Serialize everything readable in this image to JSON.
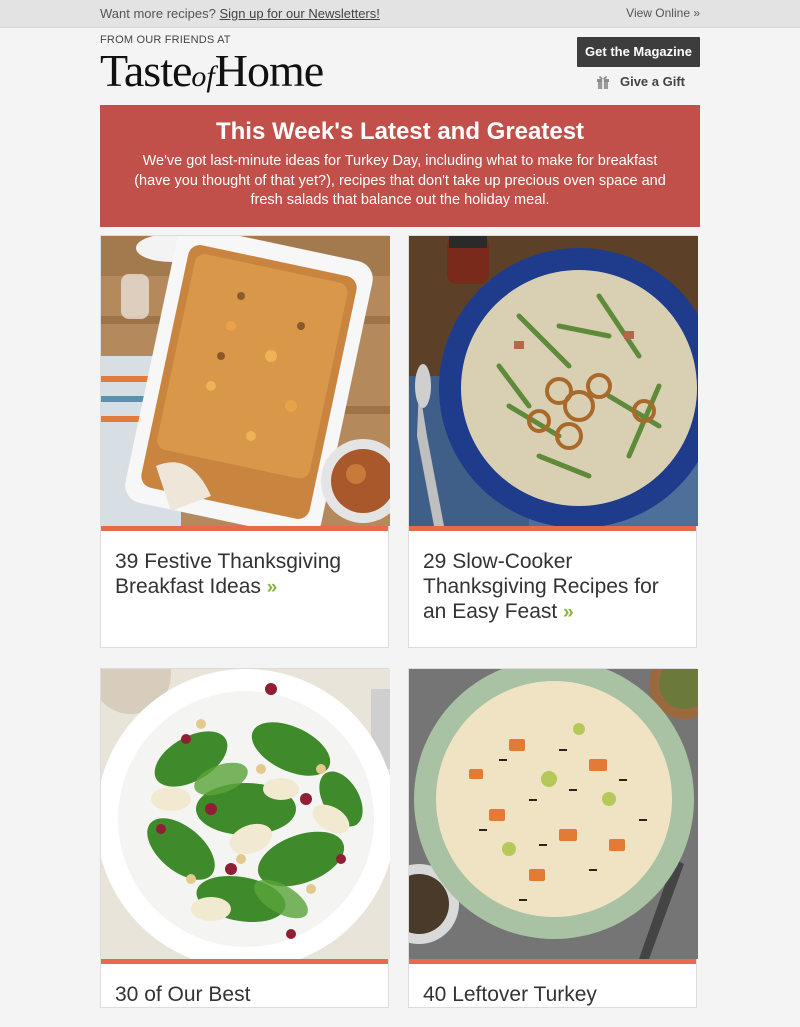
{
  "topbar": {
    "prompt": "Want more recipes?",
    "signup_link": "Sign up for our Newsletters!",
    "view_online": "View Online »"
  },
  "header": {
    "friends_label": "FROM OUR FRIENDS AT",
    "logo_part1": "Taste",
    "logo_part2": "of",
    "logo_part3": "Home",
    "magazine_button": "Get the Magazine",
    "gift_label": "Give a Gift"
  },
  "hero": {
    "title": "This Week's Latest and Greatest",
    "body": "We've got last-minute ideas for Turkey Day, including what to make for breakfast (have you thought of that yet?), recipes that don't take up precious oven space and fresh salads that balance out the holiday meal."
  },
  "cards": [
    {
      "title": "39 Festive Thanksgiving Breakfast Ideas",
      "arrow": "»",
      "image": "breakfast-casserole"
    },
    {
      "title": "29 Slow-Cooker Thanksgiving Recipes for an Easy Feast",
      "arrow": "»",
      "image": "green-bean-casserole"
    },
    {
      "title": "30 of Our Best",
      "arrow": "",
      "image": "spinach-pear-salad"
    },
    {
      "title": "40 Leftover Turkey",
      "arrow": "",
      "image": "wild-rice-soup"
    }
  ],
  "colors": {
    "hero_bg": "#c2504a",
    "accent_bar": "#e86a4e",
    "arrow": "#8ab63b",
    "button_bg": "#3d3d3d"
  }
}
